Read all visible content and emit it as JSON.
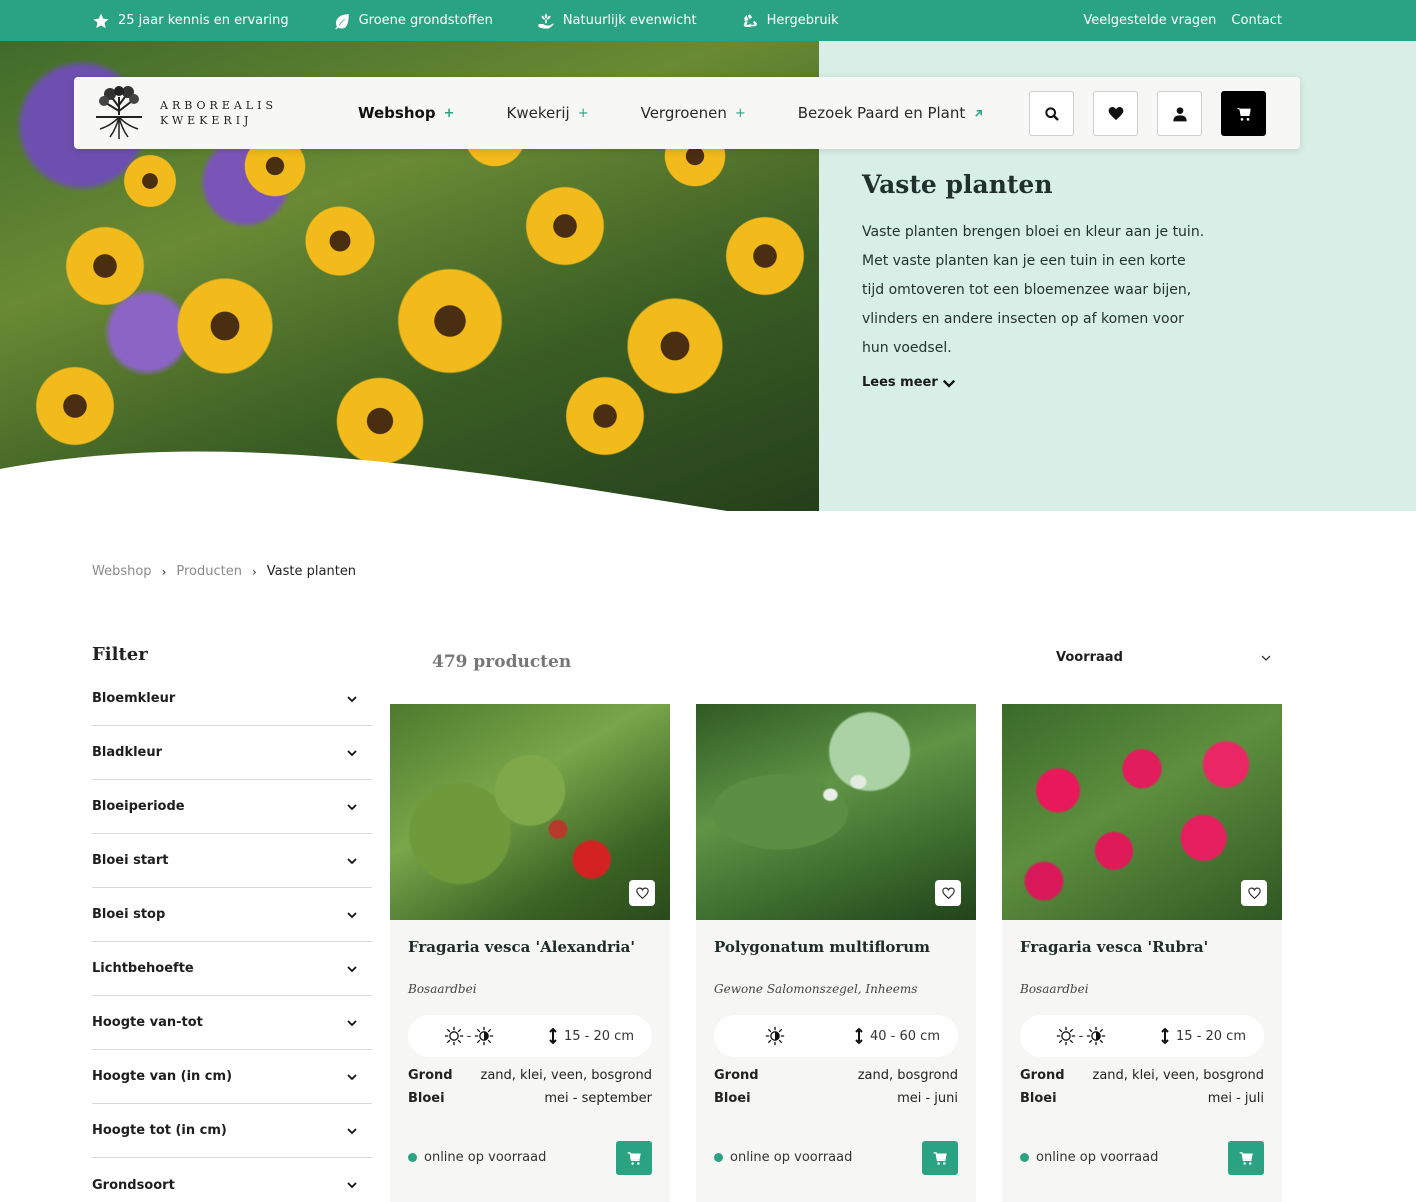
{
  "topbar": {
    "usps": [
      {
        "icon": "star-icon",
        "label": "25 jaar kennis en ervaring"
      },
      {
        "icon": "leaf-icon",
        "label": "Groene grondstoffen"
      },
      {
        "icon": "hand-plant-icon",
        "label": "Natuurlijk evenwicht"
      },
      {
        "icon": "recycle-icon",
        "label": "Hergebruik"
      }
    ],
    "links": [
      "Veelgestelde vragen",
      "Contact"
    ]
  },
  "header": {
    "logo_line1": "ARBOREALIS",
    "logo_line2": "KWEKERIJ",
    "nav": [
      {
        "label": "Webshop",
        "active": true
      },
      {
        "label": "Kwekerij"
      },
      {
        "label": "Vergroenen"
      },
      {
        "label": "Bezoek Paard en Plant"
      }
    ],
    "buttons": [
      "search-icon",
      "heart-icon",
      "user-icon",
      "cart-icon"
    ]
  },
  "hero": {
    "title": "Vaste planten",
    "text": "Vaste planten brengen bloei en kleur aan je tuin. Met vaste planten kan je een tuin in een korte tijd omtoveren tot een bloemenzee waar bijen, vlinders en andere insecten op af komen voor hun voedsel.",
    "read_more": "Lees meer"
  },
  "breadcrumb": [
    "Webshop",
    "Producten",
    "Vaste planten"
  ],
  "filter": {
    "title": "Filter",
    "items": [
      "Bloemkleur",
      "Bladkleur",
      "Bloeiperiode",
      "Bloei start",
      "Bloei stop",
      "Lichtbehoefte",
      "Hoogte van-tot",
      "Hoogte van (in cm)",
      "Hoogte tot (in cm)",
      "Grondsoort"
    ]
  },
  "products": {
    "count": "479 producten",
    "sort": "Voorraad",
    "labels": {
      "grond": "Grond",
      "bloei": "Bloei"
    },
    "items": [
      {
        "name": "Fragaria vesca 'Alexandria'",
        "common": "Bosaardbei",
        "light": "sun-halfshade",
        "height": "15 - 20 cm",
        "grond": "zand, klei, veen, bosgrond",
        "bloei": "mei - september",
        "stock": "online op voorraad"
      },
      {
        "name": "Polygonatum multiflorum",
        "common": "Gewone Salomonszegel, Inheems",
        "light": "halfshade",
        "height": "40 - 60 cm",
        "grond": "zand, bosgrond",
        "bloei": "mei - juni",
        "stock": "online op voorraad"
      },
      {
        "name": "Fragaria vesca 'Rubra'",
        "common": "Bosaardbei",
        "light": "sun-halfshade",
        "height": "15 - 20 cm",
        "grond": "zand, klei, veen, bosgrond",
        "bloei": "mei - juli",
        "stock": "online op voorraad"
      }
    ]
  },
  "colors": {
    "accent": "#2aa383",
    "hero_panel": "#d7efe6",
    "card_bg": "#f6f6f4"
  }
}
